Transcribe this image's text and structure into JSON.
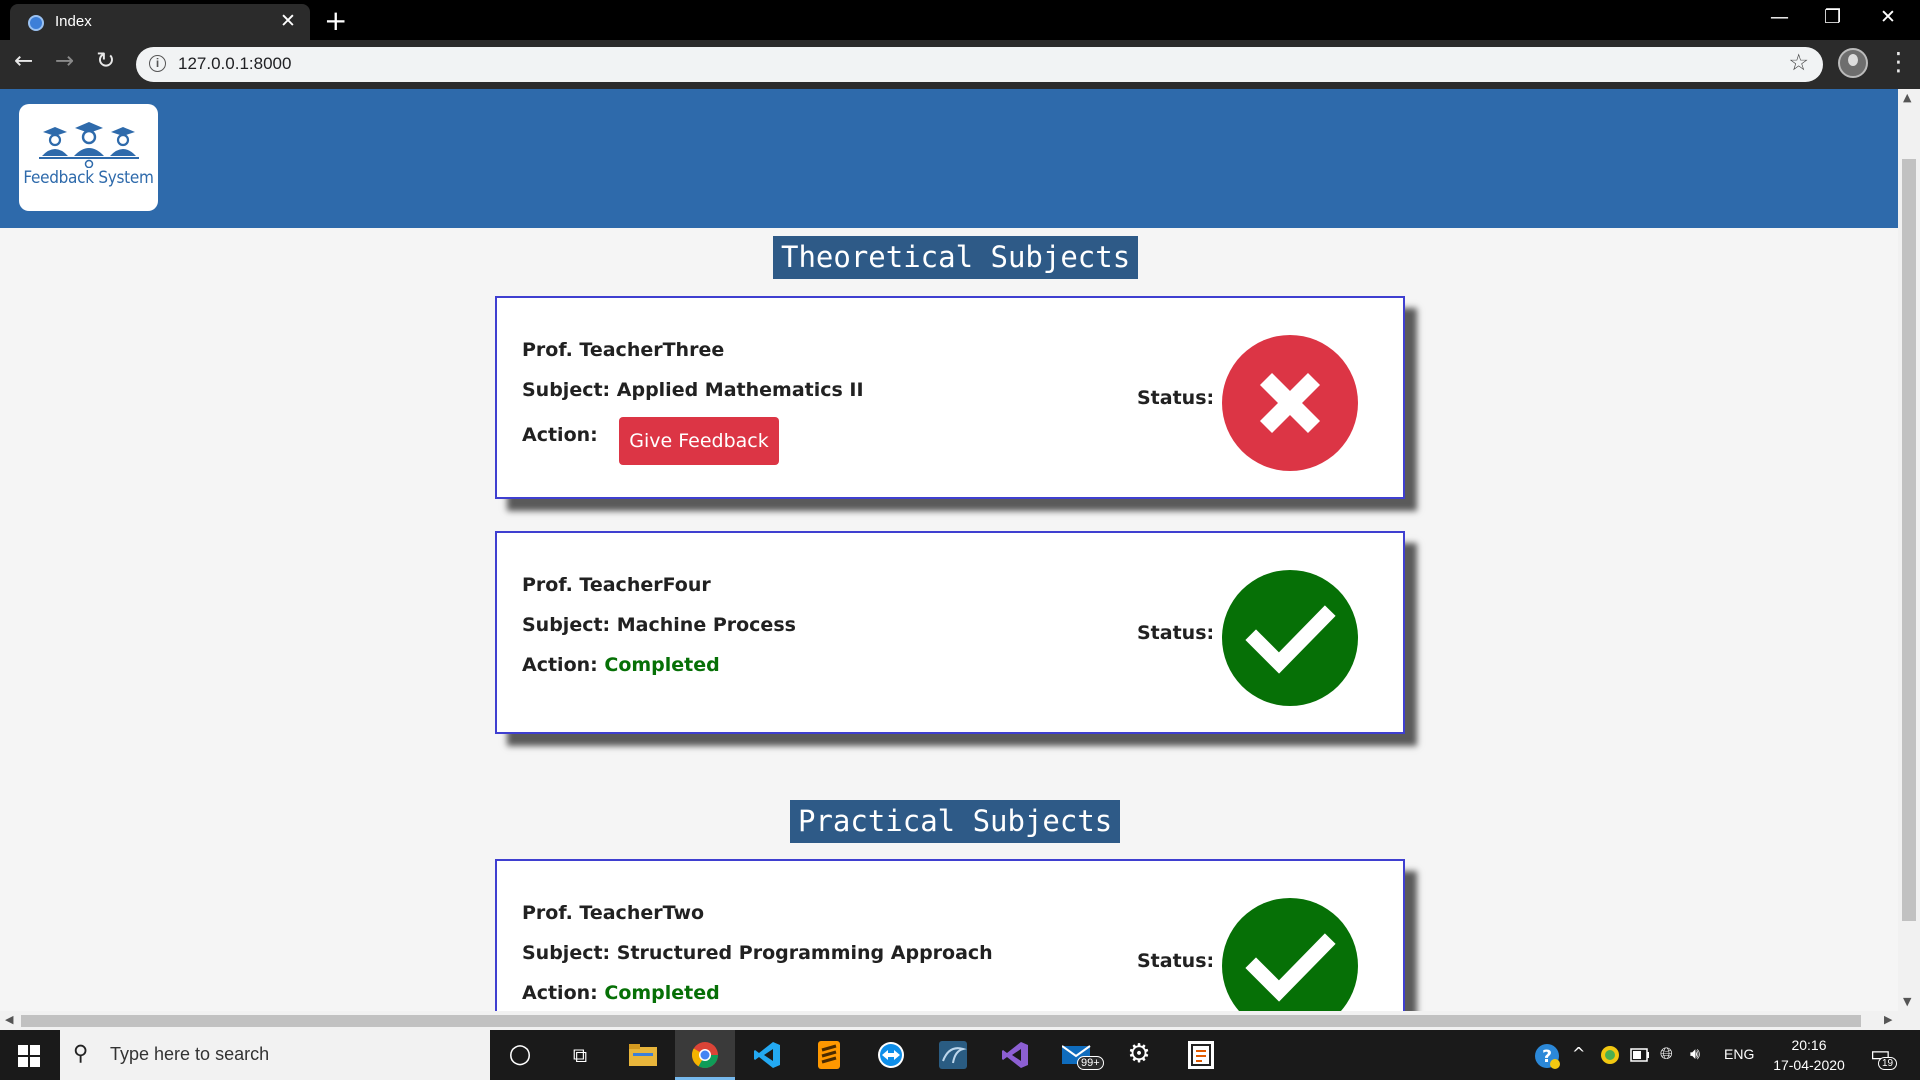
{
  "browser": {
    "tab_title": "Index",
    "tab_close": "✕",
    "new_tab": "+",
    "url": "127.0.0.1:8000",
    "info_symbol": "i",
    "star_symbol": "☆",
    "menu_symbol": "⋮",
    "back_symbol": "←",
    "forward_symbol": "→",
    "reload_symbol": "↻",
    "minimize_symbol": "—",
    "restore_symbol": "❐",
    "close_symbol": "✕"
  },
  "header": {
    "logo_text": "Feedback System"
  },
  "sections": {
    "theoretical_title": "Theoretical Subjects",
    "practical_title": "Practical Subjects"
  },
  "labels": {
    "action": "Action:",
    "status": "Status:"
  },
  "cards": [
    {
      "teacher": "Prof. TeacherThree",
      "subject": "Subject: Applied Mathematics II",
      "action_button": "Give Feedback",
      "status": "pending",
      "status_color": "#dc3545"
    },
    {
      "teacher": "Prof. TeacherFour",
      "subject": "Subject: Machine Process",
      "action_text": "Completed",
      "status": "completed",
      "status_color": "#067006"
    },
    {
      "teacher": "Prof. TeacherTwo",
      "subject": "Subject: Structured Programming Approach",
      "action_text": "Completed",
      "status": "completed",
      "status_color": "#067006"
    }
  ],
  "colors": {
    "header_bg": "#2e6aab",
    "section_title_bg": "#2e5a87",
    "card_border": "#3f3fd0",
    "danger": "#dc3545",
    "success": "#067006"
  },
  "taskbar": {
    "search_placeholder": "Type here to search",
    "mail_badge": "99+",
    "language": "ENG",
    "time": "20:16",
    "date": "17-04-2020",
    "notification_count": "19",
    "icons": [
      "windows-start-icon",
      "search-icon",
      "cortana-icon",
      "task-view-icon",
      "file-explorer-icon",
      "chrome-icon",
      "vscode-icon",
      "sublime-text-icon",
      "teamviewer-icon",
      "mysql-workbench-icon",
      "visual-studio-icon",
      "mail-icon",
      "settings-icon",
      "app-icon",
      "help-icon",
      "chevron-up-icon",
      "tray-app-icon",
      "battery-icon",
      "network-icon",
      "volume-icon",
      "notification-icon"
    ]
  }
}
